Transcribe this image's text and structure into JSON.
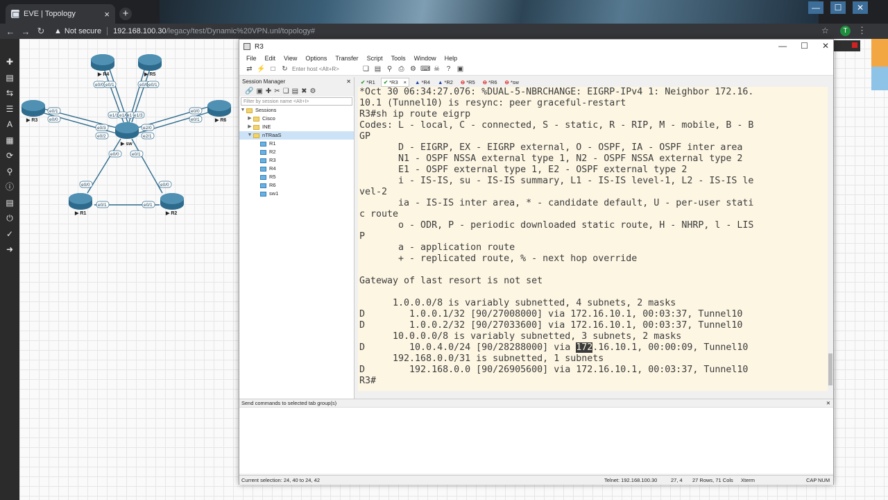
{
  "browser": {
    "tab_title": "EVE | Topology",
    "tab_close": "×",
    "new_tab": "+",
    "security_label": "Not secure",
    "url_host": "192.168.100.30",
    "url_path": "/legacy/test/Dynamic%20VPN.unl/topology#",
    "profile_initial": "T",
    "window_controls": [
      "—",
      "☐",
      "✕"
    ]
  },
  "eve_sidebar_icons": [
    "add-icon",
    "save-icon",
    "shuffle-icon",
    "list-icon",
    "text-icon",
    "grid-icon",
    "refresh-icon",
    "zoom-icon",
    "info-icon",
    "doc-icon",
    "power-icon",
    "check-icon",
    "logout-icon"
  ],
  "topology": {
    "nodes": [
      "R4",
      "R5",
      "R3",
      "R6",
      "sw",
      "R1",
      "R2"
    ],
    "ports": [
      "e0/0",
      "e0/1",
      "e0/0",
      "e0/1",
      "e0/1",
      "e0/0",
      "e0/0",
      "e0/1",
      "e1/1",
      "e1/0",
      "e1/3",
      "e0/3",
      "e0/2",
      "e2/0",
      "e2/1",
      "e0/0",
      "e0/1",
      "e0/0",
      "e0/0",
      "e0/1",
      "e0/1"
    ]
  },
  "crt": {
    "title": "R3",
    "menu": [
      "File",
      "Edit",
      "View",
      "Options",
      "Transfer",
      "Script",
      "Tools",
      "Window",
      "Help"
    ],
    "host_placeholder": "Enter host <Alt+R>",
    "session_manager": {
      "title": "Session Manager",
      "pin": "ᵖ",
      "close": "✕",
      "filter_placeholder": "Filter by session name <Alt+I>",
      "tree": {
        "root": "Sessions",
        "folders": [
          "Cisco",
          "INE",
          "nTRaaS"
        ],
        "sessions": [
          "R1",
          "R2",
          "R3",
          "R4",
          "R5",
          "R6",
          "sw1"
        ]
      }
    },
    "tabs": [
      {
        "label": "*R1",
        "status": "✔"
      },
      {
        "label": "*R3",
        "status": "✔"
      },
      {
        "label": "*R4",
        "status": "▲"
      },
      {
        "label": "*R2",
        "status": "▲"
      },
      {
        "label": "*R5",
        "status": "⊖"
      },
      {
        "label": "*R6",
        "status": "⊖"
      },
      {
        "label": "*sw",
        "status": "⊖"
      }
    ],
    "tab_close": "×",
    "terminal_lines": [
      "*Oct 30 06:34:27.076: %DUAL-5-NBRCHANGE: EIGRP-IPv4 1: Neighbor 172.16.",
      "10.1 (Tunnel10) is resync: peer graceful-restart",
      "R3#sh ip route eigrp",
      "Codes: L - local, C - connected, S - static, R - RIP, M - mobile, B - B",
      "GP",
      "       D - EIGRP, EX - EIGRP external, O - OSPF, IA - OSPF inter area",
      "       N1 - OSPF NSSA external type 1, N2 - OSPF NSSA external type 2",
      "       E1 - OSPF external type 1, E2 - OSPF external type 2",
      "       i - IS-IS, su - IS-IS summary, L1 - IS-IS level-1, L2 - IS-IS le",
      "vel-2",
      "       ia - IS-IS inter area, * - candidate default, U - per-user stati",
      "c route",
      "       o - ODR, P - periodic downloaded static route, H - NHRP, l - LIS",
      "P",
      "       a - application route",
      "       + - replicated route, % - next hop override",
      "",
      "Gateway of last resort is not set",
      "",
      "      1.0.0.0/8 is variably subnetted, 4 subnets, 2 masks",
      "D        1.0.0.1/32 [90/27008000] via 172.16.10.1, 00:03:37, Tunnel10",
      "D        1.0.0.2/32 [90/27033600] via 172.16.10.1, 00:03:37, Tunnel10",
      "      10.0.0.0/8 is variably subnetted, 3 subnets, 2 masks",
      "D        10.0.4.0/24 [90/28288000] via ",
      "      192.168.0.0/31 is subnetted, 1 subnets",
      "D        192.168.0.0 [90/26905600] via 172.16.10.1, 00:03:37, Tunnel10",
      "R3#"
    ],
    "highlight_text": "172",
    "highlight_rest": ".16.10.1, 00:00:09, Tunnel10",
    "send_commands_label": "Send commands to selected tab group(s)",
    "status": {
      "selection": "Current selection: 24, 40 to 24, 42",
      "telnet": "Telnet: 192.168.100.30",
      "position": "27,  4",
      "size": "27 Rows, 71 Cols",
      "emulation": "Xterm",
      "cap": "CAP",
      "num": "NUM"
    }
  }
}
